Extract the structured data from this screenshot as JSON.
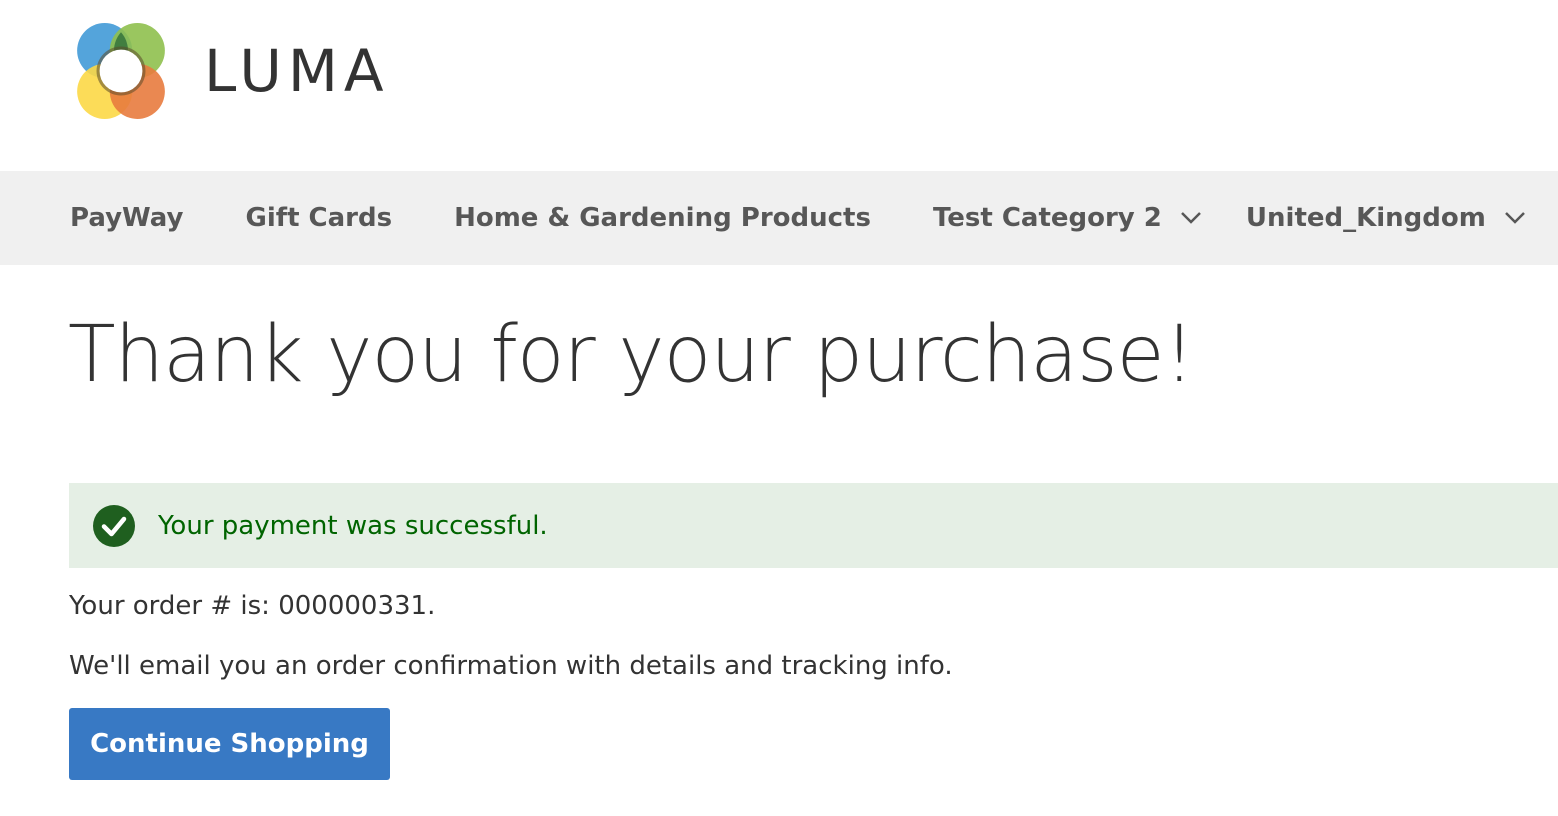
{
  "brand": {
    "name": "LUMA",
    "logo_icon": "luma-logo-icon",
    "colors": {
      "blue": "#4b9fd9",
      "green": "#8fc04e",
      "yellow": "#fcd846",
      "orange": "#e87b3e"
    }
  },
  "nav": {
    "items": [
      {
        "label": "PayWay",
        "has_submenu": false
      },
      {
        "label": "Gift Cards",
        "has_submenu": false
      },
      {
        "label": "Home & Gardening Products",
        "has_submenu": false
      },
      {
        "label": "Test Category 2",
        "has_submenu": true
      },
      {
        "label": "United_Kingdom",
        "has_submenu": true
      }
    ],
    "submenu_icon": "chevron-down-icon"
  },
  "page": {
    "title": "Thank you for your purchase!",
    "success_message": "Your payment was successful.",
    "success_icon": "check-circle-icon",
    "order_text": "Your order # is: 000000331.",
    "email_text": "We'll email you an order confirmation with details and tracking info.",
    "continue_label": "Continue Shopping"
  },
  "colors": {
    "nav_bg": "#f0f0f0",
    "success_bg": "#e5efe5",
    "success_text": "#006400",
    "button_bg": "#3879c4"
  }
}
